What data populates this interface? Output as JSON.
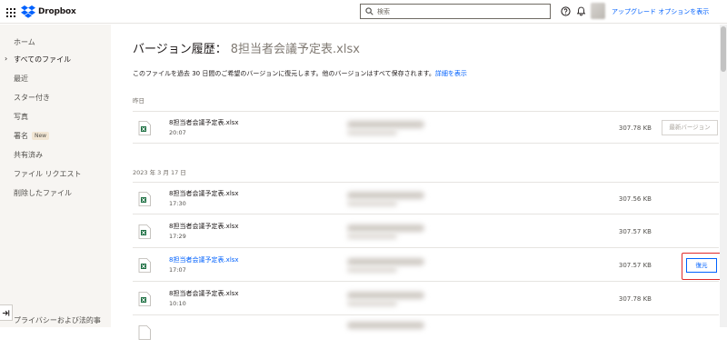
{
  "app": {
    "name": "Dropbox"
  },
  "search": {
    "placeholder": "検索"
  },
  "topbar": {
    "upgrade_label": "アップグレード オプションを表示"
  },
  "sidebar": {
    "items": [
      {
        "label": "ホーム"
      },
      {
        "label": "すべてのファイル",
        "active": true
      },
      {
        "label": "最近"
      },
      {
        "label": "スター付き"
      },
      {
        "label": "写真"
      },
      {
        "label": "署名",
        "badge": "New"
      },
      {
        "label": "共有済み"
      },
      {
        "label": "ファイル リクエスト"
      },
      {
        "label": "削除したファイル"
      }
    ],
    "footer_label": "プライバシーおよび法的事"
  },
  "main": {
    "title_prefix": "バージョン履歴：",
    "title_file": "8担当者会議予定表.xlsx",
    "description": "このファイルを過去 30 日間のご希望のバージョンに復元します。他のバージョンはすべて保存されます。",
    "details_link": "詳細を表示",
    "groups": [
      {
        "label": "昨日",
        "rows": [
          {
            "name": "8担当者会議予定表.xlsx",
            "time": "20:07",
            "size": "307.78 KB",
            "action": "最新バージョン"
          }
        ]
      },
      {
        "label": "2023 年 3 月 17 日",
        "rows": [
          {
            "name": "8担当者会議予定表.xlsx",
            "time": "17:30",
            "size": "307.56 KB"
          },
          {
            "name": "8担当者会議予定表.xlsx",
            "time": "17:29",
            "size": "307.57 KB"
          },
          {
            "name": "8担当者会議予定表.xlsx",
            "time": "17:07",
            "size": "307.57 KB",
            "action": "復元",
            "hovered": true
          },
          {
            "name": "8担当者会議予定表.xlsx",
            "time": "10:10",
            "size": "307.78 KB"
          }
        ]
      }
    ]
  },
  "colors": {
    "accent": "#0061fe",
    "sidebar_bg": "#f7f5f2",
    "highlight": "#e02929",
    "excel_green": "#1d6f42"
  }
}
